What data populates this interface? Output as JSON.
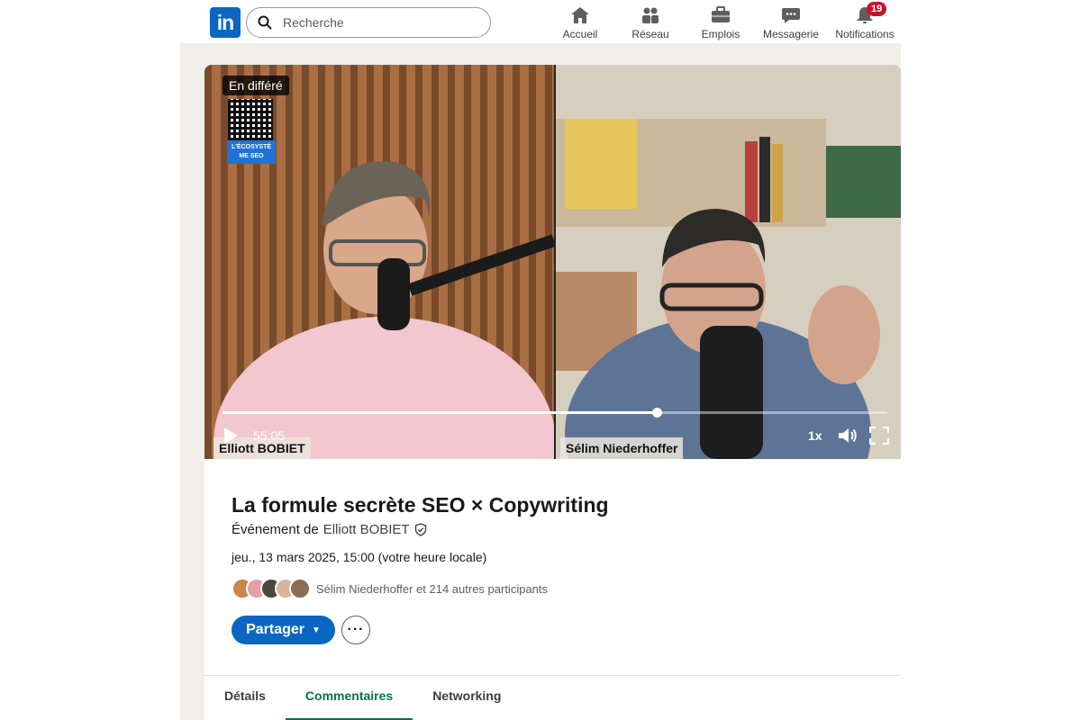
{
  "nav": {
    "logo_text": "in",
    "search_placeholder": "Recherche",
    "items": [
      {
        "label": "Accueil",
        "icon": "home-icon"
      },
      {
        "label": "Réseau",
        "icon": "network-icon"
      },
      {
        "label": "Emplois",
        "icon": "briefcase-icon"
      },
      {
        "label": "Messagerie",
        "icon": "message-icon"
      },
      {
        "label": "Notifications",
        "icon": "bell-icon",
        "badge": "19"
      }
    ],
    "badge_color": "#cb112d"
  },
  "video": {
    "status": "En différé",
    "qr_label": "L'ÉCOSYSTÈ ME SEO",
    "left_speaker": "Elliott BOBIET",
    "right_speaker": "Sélim Niederhoffer",
    "time": "55:05",
    "speed": "1x",
    "progress_fraction": 0.653
  },
  "event": {
    "title": "La formule secrète SEO × Copywriting",
    "organizer_prefix": "Événement de",
    "organizer_name": "Elliott BOBIET",
    "datetime": "jeu., 13 mars 2025, 15:00 (votre heure locale)",
    "attendees_text": "Sélim Niederhoffer et 214 autres participants",
    "share_label": "Partager",
    "more_label": "···"
  },
  "tabs": [
    {
      "label": "Détails",
      "active": false
    },
    {
      "label": "Commentaires",
      "active": true
    },
    {
      "label": "Networking",
      "active": false
    }
  ],
  "colors": {
    "brand": "#0a66c2",
    "active_tab": "#01754f"
  }
}
